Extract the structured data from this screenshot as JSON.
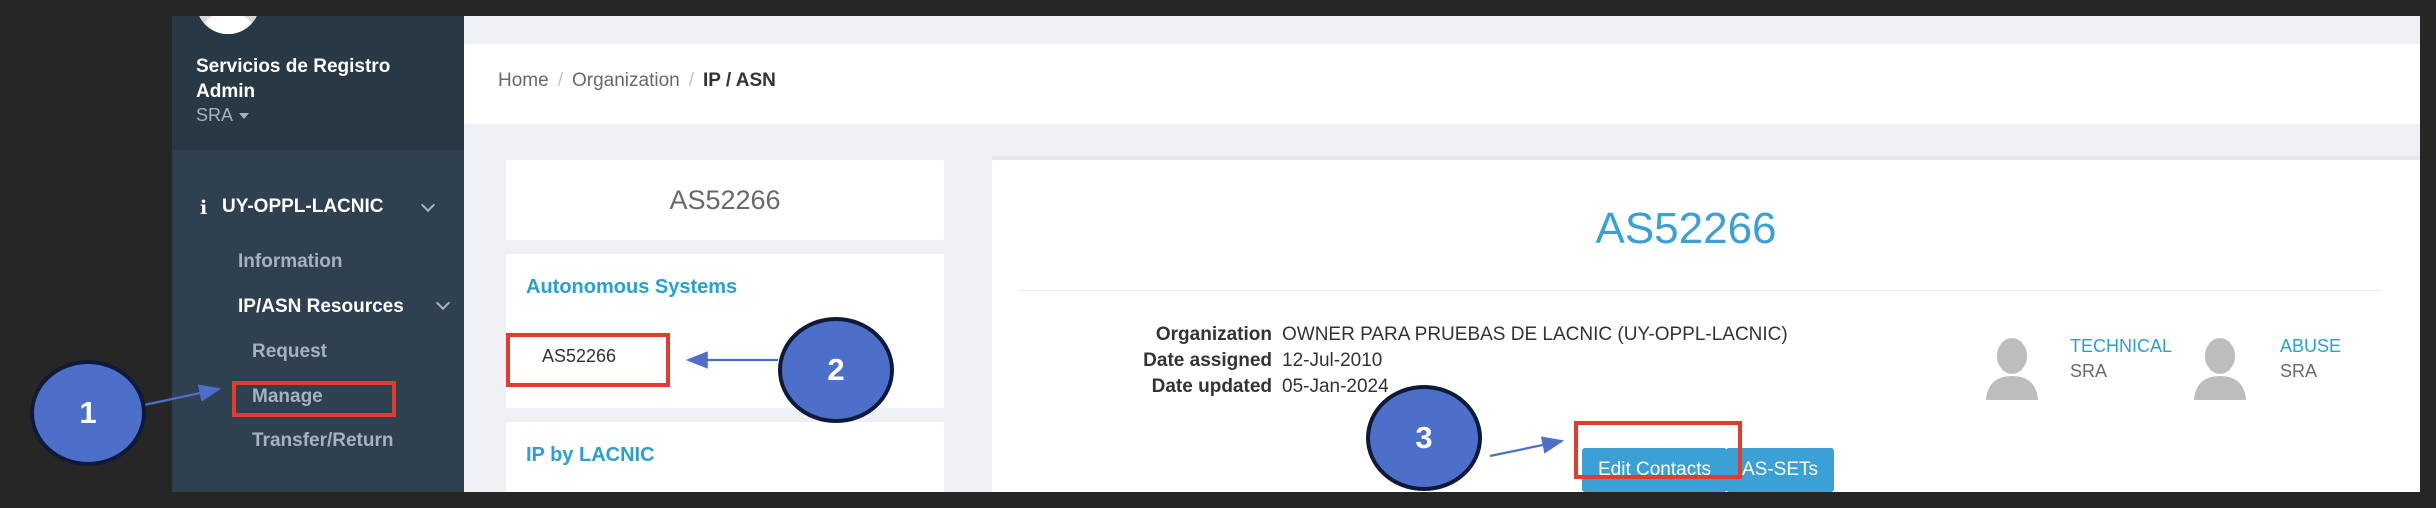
{
  "sidebar": {
    "user_name": "Servicios de Registro Admin",
    "user_role": "SRA",
    "org_code": "UY-OPPL-LACNIC",
    "items": {
      "information": "Information",
      "ip_asn_resources": "IP/ASN Resources",
      "request": "Request",
      "manage": "Manage",
      "transfer_return": "Transfer/Return"
    }
  },
  "breadcrumb": {
    "home": "Home",
    "organization": "Organization",
    "current": "IP / ASN",
    "separator": "/"
  },
  "left_panel": {
    "asn_header": "AS52266",
    "autonomous_systems_title": "Autonomous Systems",
    "as_items": [
      "AS52266"
    ],
    "ip_by_lacnic_title": "IP by LACNIC"
  },
  "detail": {
    "title": "AS52266",
    "organization_label": "Organization",
    "organization_value": "OWNER PARA PRUEBAS DE LACNIC (UY-OPPL-LACNIC)",
    "date_assigned_label": "Date assigned",
    "date_assigned_value": "12-Jul-2010",
    "date_updated_label": "Date updated",
    "date_updated_value": "05-Jan-2024",
    "contacts": [
      {
        "type": "TECHNICAL",
        "name": "SRA"
      },
      {
        "type": "ABUSE",
        "name": "SRA"
      }
    ],
    "edit_contacts_label": "Edit Contacts",
    "as_sets_label": "AS-SETs"
  },
  "annotations": {
    "step1": "1",
    "step2": "2",
    "step3": "3",
    "highlight_color": "#e33b2e",
    "marker_color": "#4d6fc9"
  },
  "colors": {
    "sidebar_bg": "#2f4050",
    "accent": "#3aa0d5"
  }
}
